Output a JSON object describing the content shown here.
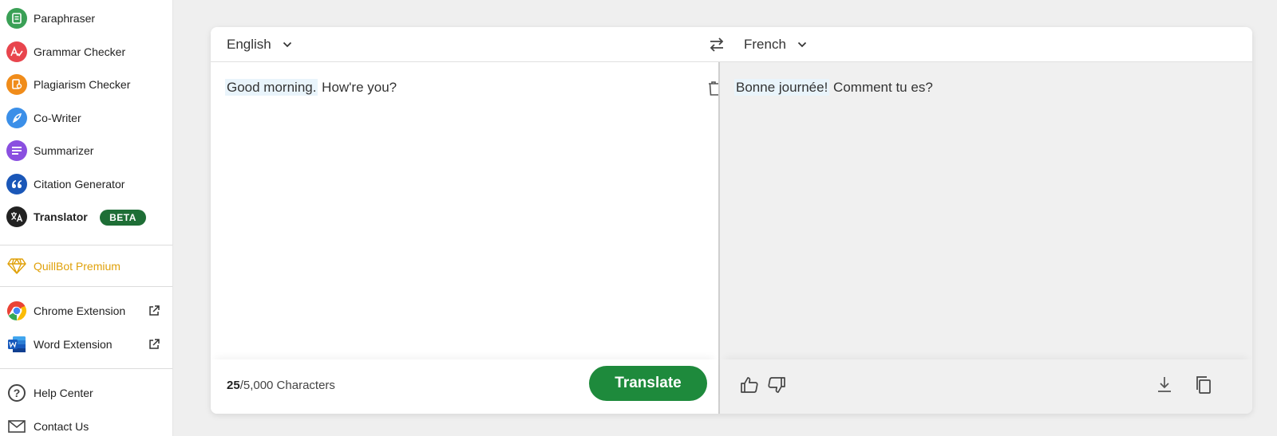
{
  "sidebar": {
    "items": [
      {
        "label": "Paraphraser",
        "color": "#3aa056"
      },
      {
        "label": "Grammar Checker",
        "color": "#e8454d"
      },
      {
        "label": "Plagiarism Checker",
        "color": "#f08c1a"
      },
      {
        "label": "Co-Writer",
        "color": "#3b8fe8"
      },
      {
        "label": "Summarizer",
        "color": "#8a4fe0"
      },
      {
        "label": "Citation Generator",
        "color": "#1a57b8"
      },
      {
        "label": "Translator",
        "color": "#222222",
        "badge": "BETA"
      }
    ],
    "premium": {
      "label": "QuillBot Premium",
      "color": "#e0a10a"
    },
    "extensions": [
      {
        "label": "Chrome Extension"
      },
      {
        "label": "Word Extension"
      }
    ],
    "support": [
      {
        "label": "Help Center"
      },
      {
        "label": "Contact Us"
      }
    ]
  },
  "translator": {
    "source_language": "English",
    "target_language": "French",
    "source_text": {
      "highlighted": "Good morning.",
      "rest": " How're you?"
    },
    "target_text": {
      "highlighted": "Bonne journée!",
      "rest": " Comment tu es?"
    },
    "char_count": {
      "current": "25",
      "limit": "/5,000 Characters"
    },
    "translate_label": "Translate",
    "accent_color": "#1e8a3c"
  }
}
